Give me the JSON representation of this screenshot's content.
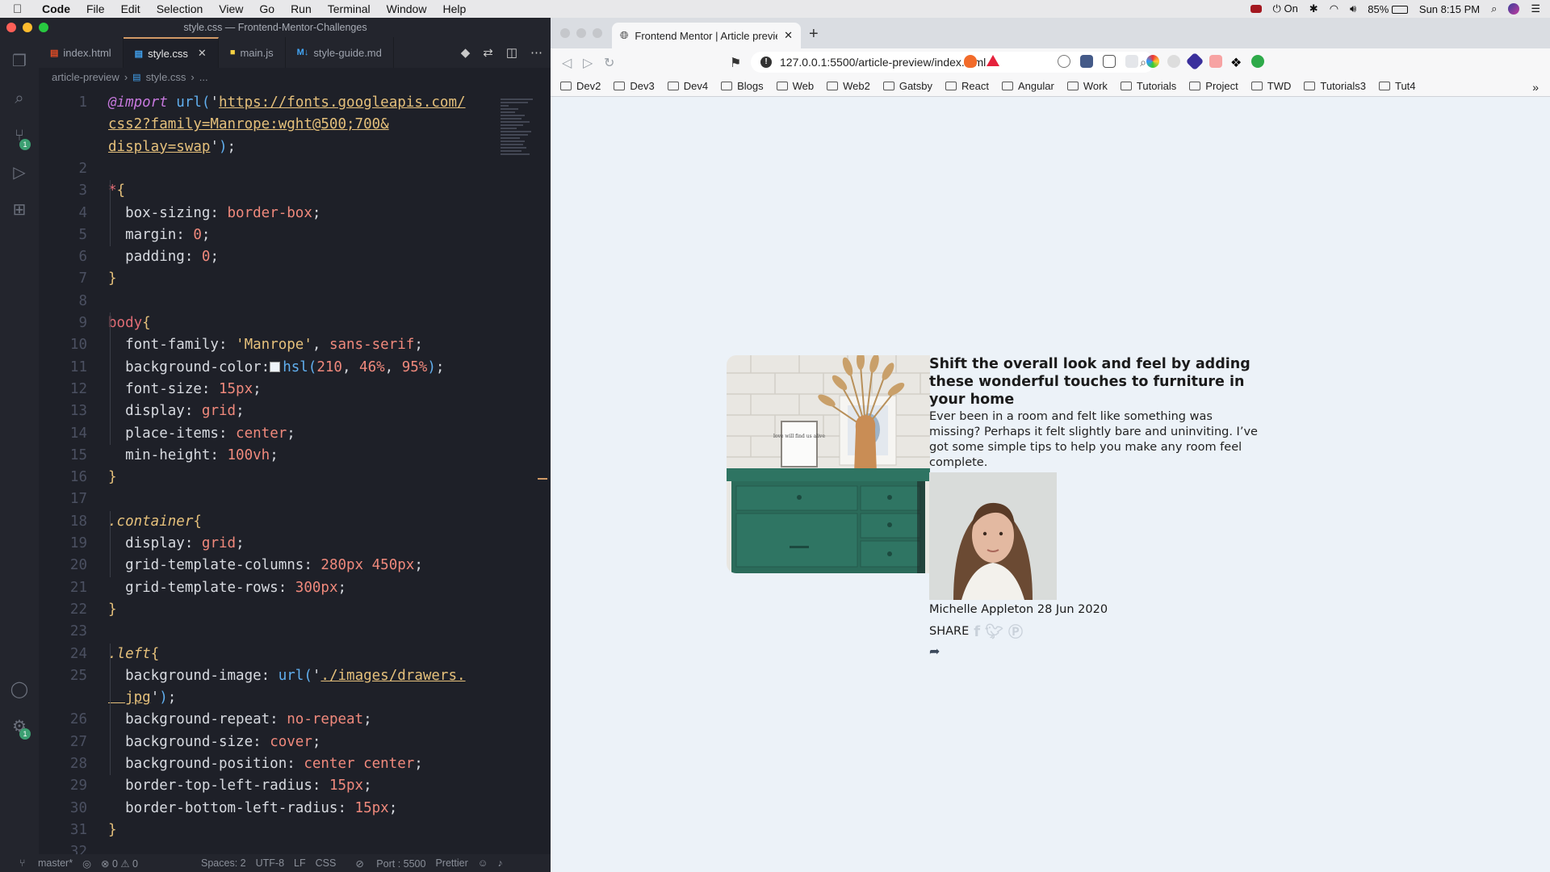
{
  "menubar": {
    "app": "Code",
    "items": [
      "File",
      "Edit",
      "Selection",
      "View",
      "Go",
      "Run",
      "Terminal",
      "Window",
      "Help"
    ],
    "status_on": "On",
    "battery": "85%",
    "clock": "Sun 8:15 PM"
  },
  "vscode": {
    "window_title": "style.css — Frontend-Mentor-Challenges",
    "tabs": [
      {
        "label": "index.html",
        "icon": "html-icon"
      },
      {
        "label": "style.css",
        "icon": "css-icon"
      },
      {
        "label": "main.js",
        "icon": "js-icon"
      },
      {
        "label": "style-guide.md",
        "icon": "markdown-icon"
      }
    ],
    "breadcrumb": {
      "folder": "article-preview",
      "file": "style.css",
      "rest": "..."
    },
    "badges": {
      "scm": "1",
      "settings": "1"
    },
    "code_lines": [
      {
        "n": "1",
        "parts": [
          [
            "c-at",
            "@import "
          ],
          [
            "c-fn",
            "url("
          ],
          [
            "c-pun",
            "'"
          ],
          [
            "c-str",
            "https://fonts.googleapis.com/"
          ]
        ]
      },
      {
        "n": "",
        "parts": [
          [
            "c-str",
            "css2?family=Manrope:wght@500;700&"
          ]
        ]
      },
      {
        "n": "",
        "parts": [
          [
            "c-str",
            "display=swap"
          ],
          [
            "c-pun",
            "'"
          ],
          [
            "c-fn",
            ")"
          ],
          [
            "c-pun",
            ";"
          ]
        ]
      },
      {
        "n": "2",
        "parts": []
      },
      {
        "n": "3",
        "parts": [
          [
            "c-sel",
            "*"
          ],
          [
            "c-br",
            "{"
          ]
        ]
      },
      {
        "n": "4",
        "parts": [
          [
            "c-prop",
            "  box-sizing: "
          ],
          [
            "c-val",
            "border-box"
          ],
          [
            "c-pun",
            ";"
          ]
        ]
      },
      {
        "n": "5",
        "parts": [
          [
            "c-prop",
            "  margin: "
          ],
          [
            "c-num",
            "0"
          ],
          [
            "c-pun",
            ";"
          ]
        ]
      },
      {
        "n": "6",
        "parts": [
          [
            "c-prop",
            "  padding: "
          ],
          [
            "c-num",
            "0"
          ],
          [
            "c-pun",
            ";"
          ]
        ]
      },
      {
        "n": "7",
        "parts": [
          [
            "c-br",
            "}"
          ]
        ]
      },
      {
        "n": "8",
        "parts": []
      },
      {
        "n": "9",
        "parts": [
          [
            "c-sel",
            "body"
          ],
          [
            "c-br",
            "{"
          ]
        ]
      },
      {
        "n": "10",
        "parts": [
          [
            "c-prop",
            "  font-family: "
          ],
          [
            "c-fam",
            "'Manrope'"
          ],
          [
            "c-pun",
            ", "
          ],
          [
            "c-val",
            "sans-serif"
          ],
          [
            "c-pun",
            ";"
          ]
        ]
      },
      {
        "n": "11",
        "parts": [
          [
            "c-prop",
            "  background-color:"
          ],
          [
            "swatch",
            ""
          ],
          [
            "c-fn",
            "hsl("
          ],
          [
            "c-num",
            "210"
          ],
          [
            "c-pun",
            ", "
          ],
          [
            "c-num",
            "46%"
          ],
          [
            "c-pun",
            ", "
          ],
          [
            "c-num",
            "95%"
          ],
          [
            "c-fn",
            ")"
          ],
          [
            "c-pun",
            ";"
          ]
        ]
      },
      {
        "n": "12",
        "parts": [
          [
            "c-prop",
            "  font-size: "
          ],
          [
            "c-num",
            "15px"
          ],
          [
            "c-pun",
            ";"
          ]
        ]
      },
      {
        "n": "13",
        "parts": [
          [
            "c-prop",
            "  display: "
          ],
          [
            "c-val",
            "grid"
          ],
          [
            "c-pun",
            ";"
          ]
        ]
      },
      {
        "n": "14",
        "parts": [
          [
            "c-prop",
            "  place-items: "
          ],
          [
            "c-val",
            "center"
          ],
          [
            "c-pun",
            ";"
          ]
        ]
      },
      {
        "n": "15",
        "parts": [
          [
            "c-prop",
            "  min-height: "
          ],
          [
            "c-num",
            "100vh"
          ],
          [
            "c-pun",
            ";"
          ]
        ]
      },
      {
        "n": "16",
        "parts": [
          [
            "c-br",
            "}"
          ]
        ]
      },
      {
        "n": "17",
        "parts": []
      },
      {
        "n": "18",
        "parts": [
          [
            "c-cls",
            ".container"
          ],
          [
            "c-br",
            "{"
          ]
        ]
      },
      {
        "n": "19",
        "parts": [
          [
            "c-prop",
            "  display: "
          ],
          [
            "c-val",
            "grid"
          ],
          [
            "c-pun",
            ";"
          ]
        ]
      },
      {
        "n": "20",
        "parts": [
          [
            "c-prop",
            "  grid-template-columns: "
          ],
          [
            "c-num",
            "280px 450px"
          ],
          [
            "c-pun",
            ";"
          ]
        ]
      },
      {
        "n": "21",
        "parts": [
          [
            "c-prop",
            "  grid-template-rows: "
          ],
          [
            "c-num",
            "300px"
          ],
          [
            "c-pun",
            ";"
          ]
        ]
      },
      {
        "n": "22",
        "parts": [
          [
            "c-br",
            "}"
          ]
        ]
      },
      {
        "n": "23",
        "parts": []
      },
      {
        "n": "24",
        "parts": [
          [
            "c-cls",
            ".left"
          ],
          [
            "c-br",
            "{"
          ]
        ]
      },
      {
        "n": "25",
        "parts": [
          [
            "c-prop",
            "  background-image: "
          ],
          [
            "c-fn",
            "url("
          ],
          [
            "c-pun",
            "'"
          ],
          [
            "c-str",
            "./images/drawers."
          ]
        ]
      },
      {
        "n": "",
        "parts": [
          [
            "c-str",
            "  jpg"
          ],
          [
            "c-pun",
            "'"
          ],
          [
            "c-fn",
            ")"
          ],
          [
            "c-pun",
            ";"
          ]
        ]
      },
      {
        "n": "26",
        "parts": [
          [
            "c-prop",
            "  background-repeat: "
          ],
          [
            "c-val",
            "no-repeat"
          ],
          [
            "c-pun",
            ";"
          ]
        ]
      },
      {
        "n": "27",
        "parts": [
          [
            "c-prop",
            "  background-size: "
          ],
          [
            "c-val",
            "cover"
          ],
          [
            "c-pun",
            ";"
          ]
        ]
      },
      {
        "n": "28",
        "parts": [
          [
            "c-prop",
            "  background-position: "
          ],
          [
            "c-val",
            "center center"
          ],
          [
            "c-pun",
            ";"
          ]
        ]
      },
      {
        "n": "29",
        "parts": [
          [
            "c-prop",
            "  border-top-left-radius: "
          ],
          [
            "c-num",
            "15px"
          ],
          [
            "c-pun",
            ";"
          ]
        ]
      },
      {
        "n": "30",
        "parts": [
          [
            "c-prop",
            "  border-bottom-left-radius: "
          ],
          [
            "c-num",
            "15px"
          ],
          [
            "c-pun",
            ";"
          ]
        ]
      },
      {
        "n": "31",
        "parts": [
          [
            "c-br",
            "}"
          ]
        ]
      },
      {
        "n": "32",
        "parts": []
      }
    ],
    "status": {
      "branch": "master*",
      "problems": "⊗ 0 ⚠ 0",
      "spaces": "Spaces: 2",
      "encoding": "UTF-8",
      "eol": "LF",
      "language": "CSS",
      "port": "Port : 5500",
      "formatter": "Prettier"
    }
  },
  "browser": {
    "tab_title": "Frontend Mentor | Article previe",
    "url": "127.0.0.1:5500/article-preview/index.html",
    "bookmarks": [
      "Dev2",
      "Dev3",
      "Dev4",
      "Blogs",
      "Web",
      "Web2",
      "Gatsby",
      "React",
      "Angular",
      "Work",
      "Tutorials",
      "Project",
      "TWD",
      "Tutorials3",
      "Tut4"
    ],
    "more": "»"
  },
  "article": {
    "headline": "Shift the overall look and feel by adding these wonderful touches to furniture in your home",
    "excerpt": "Ever been in a room and felt like something was missing? Perhaps it felt slightly bare and uninviting. I’ve got some simple tips to help you make any room feel complete.",
    "author_date": "Michelle Appleton 28 Jun 2020",
    "share_label": "SHARE",
    "img_note": "love will find us alive"
  }
}
